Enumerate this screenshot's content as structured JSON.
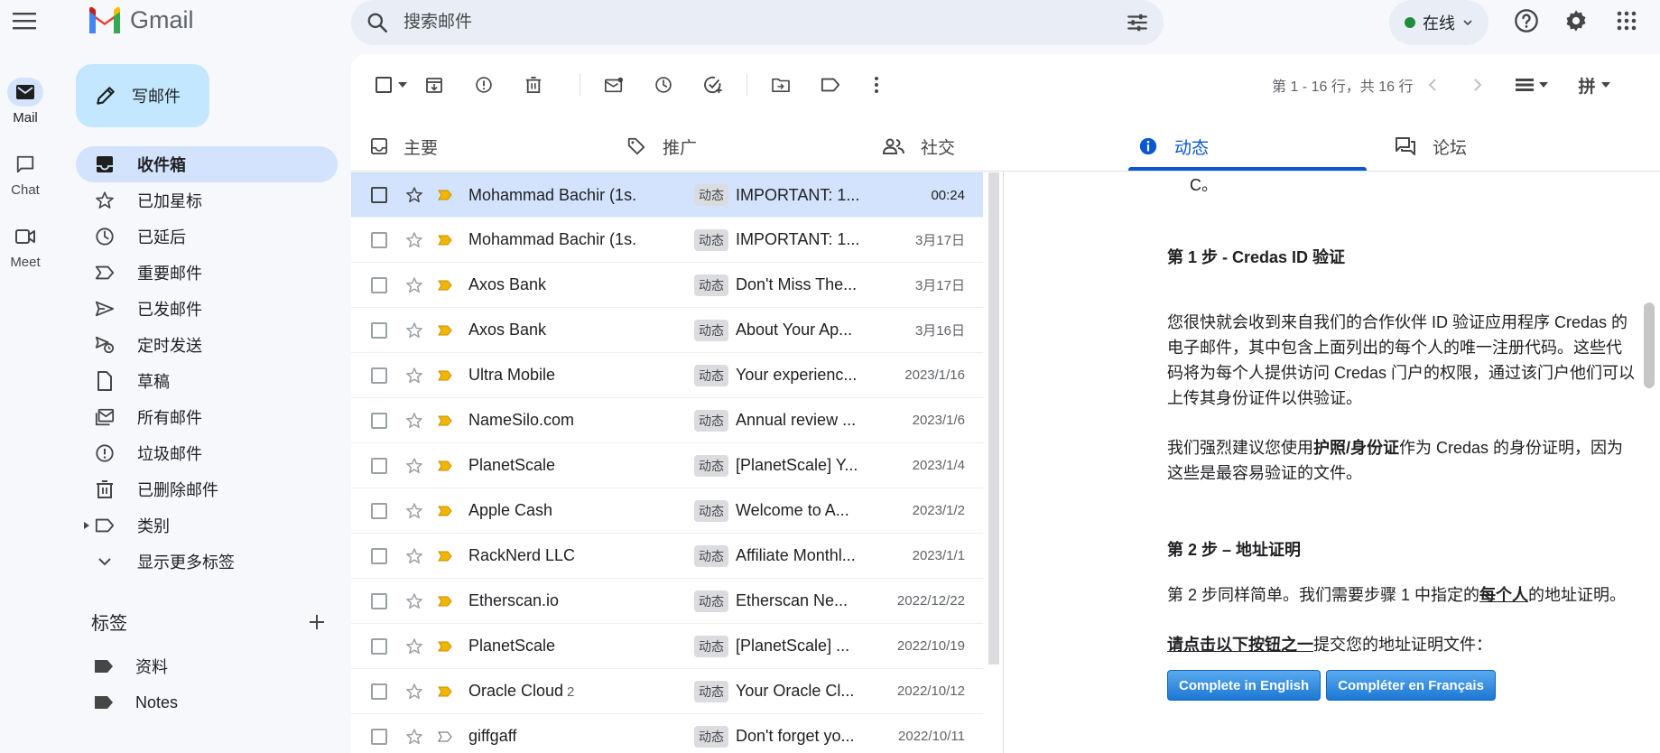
{
  "app": {
    "name": "Gmail"
  },
  "search": {
    "placeholder": "搜索邮件"
  },
  "status": {
    "label": "在线",
    "color": "#1e8e3e"
  },
  "rail": [
    {
      "label": "Mail",
      "icon": "mail-icon"
    },
    {
      "label": "Chat",
      "icon": "chat-icon"
    },
    {
      "label": "Meet",
      "icon": "video-icon"
    }
  ],
  "compose": {
    "label": "写邮件"
  },
  "nav": {
    "items": [
      {
        "label": "收件箱",
        "icon": "inbox-icon"
      },
      {
        "label": "已加星标",
        "icon": "star-icon"
      },
      {
        "label": "已延后",
        "icon": "clock-icon"
      },
      {
        "label": "重要邮件",
        "icon": "important-icon"
      },
      {
        "label": "已发邮件",
        "icon": "send-icon"
      },
      {
        "label": "定时发送",
        "icon": "schedule-send-icon"
      },
      {
        "label": "草稿",
        "icon": "draft-icon"
      },
      {
        "label": "所有邮件",
        "icon": "all-mail-icon"
      },
      {
        "label": "垃圾邮件",
        "icon": "spam-icon"
      },
      {
        "label": "已删除邮件",
        "icon": "trash-icon"
      },
      {
        "label": "类别",
        "icon": "label-outline-icon"
      },
      {
        "label": "显示更多标签",
        "icon": "chevron-down-icon"
      }
    ]
  },
  "labels": {
    "title": "标签",
    "items": [
      {
        "label": "资料"
      },
      {
        "label": "Notes"
      }
    ]
  },
  "toolbar": {
    "page_info": "第 1 - 16 行，共 16 行",
    "input_tool": "拼"
  },
  "tabs": [
    {
      "label": "主要",
      "icon": "inbox-icon"
    },
    {
      "label": "推广",
      "icon": "tag-icon"
    },
    {
      "label": "社交",
      "icon": "people-icon"
    },
    {
      "label": "动态",
      "icon": "info-icon"
    },
    {
      "label": "论坛",
      "icon": "forum-icon"
    }
  ],
  "emails": [
    {
      "sender": "Mohammad Bachir (1s.",
      "count": "",
      "badge": "动态",
      "subject": "IMPORTANT: 1...",
      "date": "00:24"
    },
    {
      "sender": "Mohammad Bachir (1s.",
      "count": "",
      "badge": "动态",
      "subject": "IMPORTANT: 1...",
      "date": "3月17日"
    },
    {
      "sender": "Axos Bank",
      "count": "",
      "badge": "动态",
      "subject": "Don't Miss The...",
      "date": "3月17日"
    },
    {
      "sender": "Axos Bank",
      "count": "",
      "badge": "动态",
      "subject": "About Your Ap...",
      "date": "3月16日"
    },
    {
      "sender": "Ultra Mobile",
      "count": "",
      "badge": "动态",
      "subject": "Your experienc...",
      "date": "2023/1/16"
    },
    {
      "sender": "NameSilo.com",
      "count": "",
      "badge": "动态",
      "subject": "Annual review ...",
      "date": "2023/1/6"
    },
    {
      "sender": "PlanetScale",
      "count": "",
      "badge": "动态",
      "subject": "[PlanetScale] Y...",
      "date": "2023/1/4"
    },
    {
      "sender": "Apple Cash",
      "count": "",
      "badge": "动态",
      "subject": "Welcome to A...",
      "date": "2023/1/2"
    },
    {
      "sender": "RackNerd LLC",
      "count": "",
      "badge": "动态",
      "subject": "Affiliate Monthl...",
      "date": "2023/1/1"
    },
    {
      "sender": "Etherscan.io",
      "count": "",
      "badge": "动态",
      "subject": "Etherscan Ne...",
      "date": "2022/12/22"
    },
    {
      "sender": "PlanetScale",
      "count": "",
      "badge": "动态",
      "subject": "[PlanetScale] ...",
      "date": "2022/10/19"
    },
    {
      "sender": "Oracle Cloud",
      "count": "2",
      "badge": "动态",
      "subject": "Your Oracle Cl...",
      "date": "2022/10/12"
    },
    {
      "sender": "giffgaff",
      "count": "",
      "badge": "动态",
      "subject": "Don't forget yo...",
      "date": "2022/10/11"
    }
  ],
  "reader": {
    "top_fragment": "C。",
    "step1_title": "第 1 步 - Credas ID 验证",
    "step1_p1": "您很快就会收到来自我们的合作伙伴 ID 验证应用程序 Credas 的电子邮件，其中包含上面列出的每个人的唯一注册代码。这些代码将为每个人提供访问 Credas 门户的权限，通过该门户他们可以上传其身份证件以供验证。",
    "step1_p2_before": "我们强烈建议您使用",
    "step1_p2_bold": "护照/身份证",
    "step1_p2_after": "作为 Credas 的身份证明，因为这些是最容易验证的文件。",
    "step2_title": "第 2 步 – 地址证明",
    "step2_p1_before": "第 2 步同样简单。我们需要步骤 1 中指定的",
    "step2_p1_bold": "每个人",
    "step2_p1_after": "的地址证明。",
    "step2_p2_bold": "请点击以下按钮之一",
    "step2_p2_after": "提交您的地址证明文件：",
    "btn_en": "Complete in English",
    "btn_fr": "Compléter en Français"
  }
}
